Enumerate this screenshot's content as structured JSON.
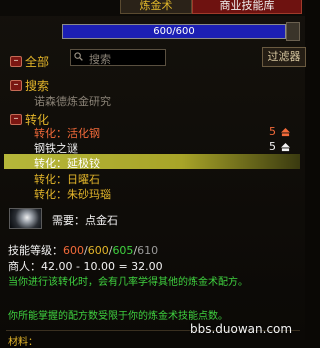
{
  "tabs": {
    "tab_a": "炼金术",
    "tab_b": "商业技能库"
  },
  "progress": {
    "text": "600/600",
    "fraction": 1.0
  },
  "tree": {
    "all_label": "全部",
    "search_header": "搜索",
    "search_placeholder": "搜索",
    "filter_button": "过滤器",
    "trainer_line": "诺森德炼金研究",
    "transmute_header": "转化",
    "rows": [
      {
        "label": "转化：活化钢",
        "count": "5",
        "color": "#f26a3a"
      },
      {
        "label": "钢铁之谜",
        "count": "5",
        "color": "#f2f2f2"
      },
      {
        "label": "转化：延极铰",
        "count": "",
        "color": "#ffffff",
        "selected": true
      },
      {
        "label": "转化：日曜石",
        "count": "",
        "color": "#e3b52a"
      },
      {
        "label": "转化：朱砂玛瑙",
        "count": "",
        "color": "#e3b52a"
      }
    ]
  },
  "details": {
    "requires_prefix": "需要：",
    "requires_value": "点金石",
    "skill_level_label": "技能等级：",
    "skill_levels": [
      "600",
      "600",
      "605",
      "610"
    ],
    "skill_colors": [
      "#f26a3a",
      "#e3b52a",
      "#3fd13f",
      "#9a9a9a"
    ],
    "merchant_line": "商人：42.00 - 10.00 = 32.00",
    "note_line": "当你进行该转化时，会有几率学得其他的炼金术配方。",
    "bottom_line": "你所能掌握的配方数受限于你的炼金术技能点数。",
    "footer_label": "材料："
  },
  "watermark": "bbs.duowan.com"
}
